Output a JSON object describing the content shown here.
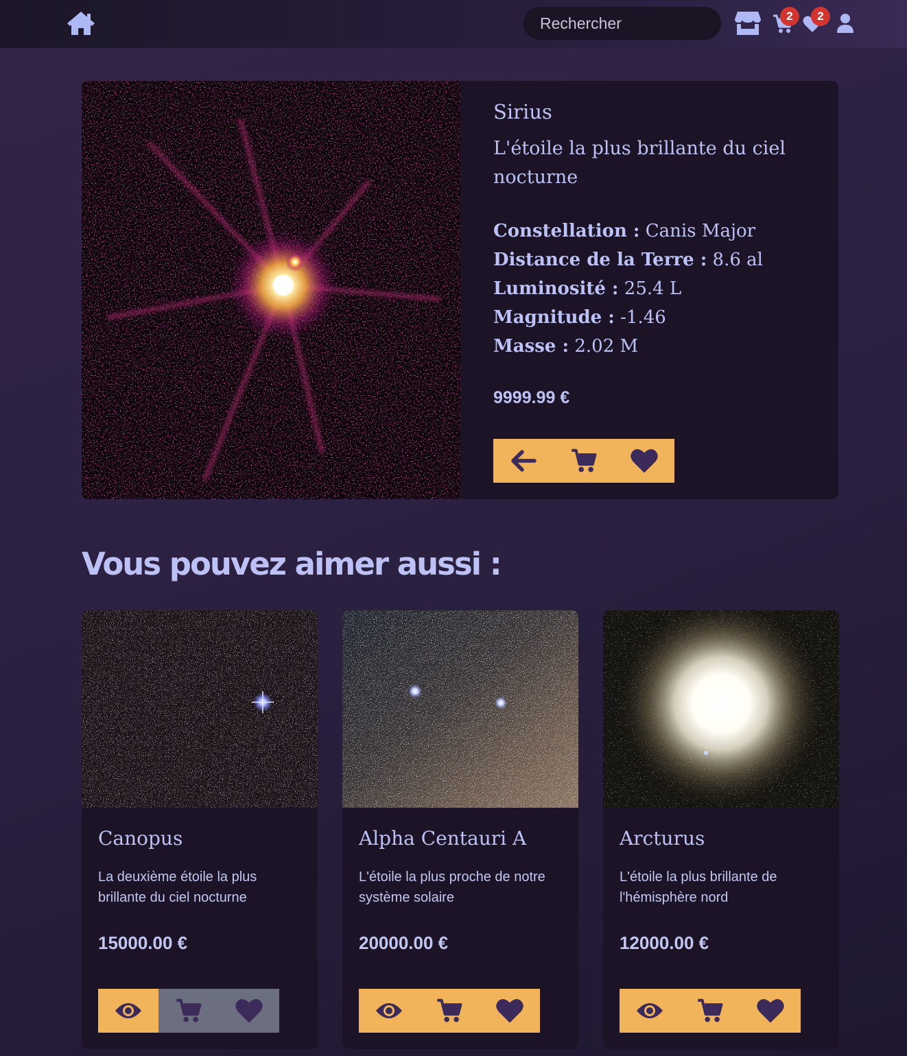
{
  "nav": {
    "home_icon": "home-icon",
    "search_placeholder": "Rechercher",
    "store_icon": "store-icon",
    "cart_icon": "cart-icon",
    "cart_count": "2",
    "wishlist_icon": "heart-icon",
    "wishlist_count": "2",
    "user_icon": "user-icon"
  },
  "product": {
    "name": "Sirius",
    "description": "L'étoile la plus brillante du ciel nocturne",
    "specs": [
      {
        "label": "Constellation :",
        "value": " Canis Major"
      },
      {
        "label": "Distance de la Terre :",
        "value": " 8.6 al"
      },
      {
        "label": "Luminosité :",
        "value": " 25.4 L"
      },
      {
        "label": "Magnitude :",
        "value": " -1.46"
      },
      {
        "label": "Masse :",
        "value": " 2.02 M"
      }
    ],
    "price": "9999.99 €",
    "actions": [
      "back-arrow-icon",
      "cart-icon",
      "heart-icon"
    ]
  },
  "related": {
    "title": "Vous pouvez aimer aussi :",
    "cards": [
      {
        "name": "Canopus",
        "description": "La deuxième étoile la plus brillante du ciel nocturne",
        "price": "15000.00 €"
      },
      {
        "name": "Alpha Centauri A",
        "description": "L'étoile la plus proche de notre système solaire",
        "price": "20000.00 €"
      },
      {
        "name": "Arcturus",
        "description": "L'étoile la plus brillante de l'hémisphère nord",
        "price": "12000.00 €"
      }
    ]
  },
  "colors": {
    "accent": "#f2b45a",
    "text": "#bcc2f5",
    "card_bg": "#1c1426",
    "icon_dark": "#3b2a5a",
    "badge": "#d2352f",
    "disabled": "#6b6f80"
  }
}
